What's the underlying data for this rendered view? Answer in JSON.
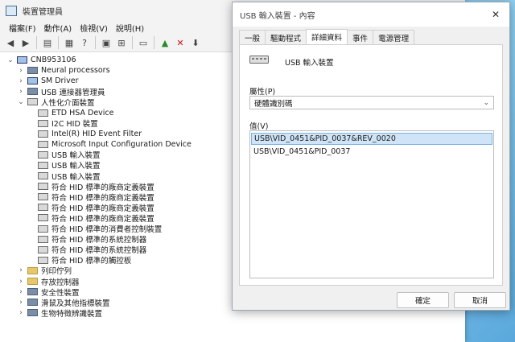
{
  "devmgr": {
    "title": "裝置管理員",
    "menu": [
      "檔案(F)",
      "動作(A)",
      "檢視(V)",
      "說明(H)"
    ],
    "tree": [
      {
        "label": "CNB953106",
        "level": 0,
        "expander": "v",
        "icon": "computer-icon"
      },
      {
        "label": "Neural processors",
        "level": 1,
        "expander": ">",
        "icon": "chip-icon"
      },
      {
        "label": "SM Driver",
        "level": 1,
        "expander": ">",
        "icon": "monitor-icon"
      },
      {
        "label": "USB 連接器管理員",
        "level": 1,
        "expander": ">",
        "icon": "usb-icon"
      },
      {
        "label": "人性化介面裝置",
        "level": 1,
        "expander": "v",
        "icon": "hid-icon"
      },
      {
        "label": "ETD HSA Device",
        "level": 2,
        "expander": "",
        "icon": "hid-icon"
      },
      {
        "label": "I2C HID 裝置",
        "level": 2,
        "expander": "",
        "icon": "hid-icon"
      },
      {
        "label": "Intel(R) HID Event Filter",
        "level": 2,
        "expander": "",
        "icon": "hid-icon"
      },
      {
        "label": "Microsoft Input Configuration Device",
        "level": 2,
        "expander": "",
        "icon": "hid-icon"
      },
      {
        "label": "USB 輸入裝置",
        "level": 2,
        "expander": "",
        "icon": "hid-icon"
      },
      {
        "label": "USB 輸入裝置",
        "level": 2,
        "expander": "",
        "icon": "hid-icon"
      },
      {
        "label": "USB 輸入裝置",
        "level": 2,
        "expander": "",
        "icon": "hid-icon"
      },
      {
        "label": "符合 HID 標準的廠商定義裝置",
        "level": 2,
        "expander": "",
        "icon": "hid-icon"
      },
      {
        "label": "符合 HID 標準的廠商定義裝置",
        "level": 2,
        "expander": "",
        "icon": "hid-icon"
      },
      {
        "label": "符合 HID 標準的廠商定義裝置",
        "level": 2,
        "expander": "",
        "icon": "hid-icon"
      },
      {
        "label": "符合 HID 標準的廠商定義裝置",
        "level": 2,
        "expander": "",
        "icon": "hid-icon"
      },
      {
        "label": "符合 HID 標準的消費者控制裝置",
        "level": 2,
        "expander": "",
        "icon": "hid-icon"
      },
      {
        "label": "符合 HID 標準的系統控制器",
        "level": 2,
        "expander": "",
        "icon": "hid-icon"
      },
      {
        "label": "符合 HID 標準的系統控制器",
        "level": 2,
        "expander": "",
        "icon": "hid-icon"
      },
      {
        "label": "符合 HID 標準的觸控板",
        "level": 2,
        "expander": "",
        "icon": "hid-icon"
      },
      {
        "label": "列印佇列",
        "level": 1,
        "expander": ">",
        "icon": "printer-icon"
      },
      {
        "label": "存放控制器",
        "level": 1,
        "expander": ">",
        "icon": "storage-icon"
      },
      {
        "label": "安全性裝置",
        "level": 1,
        "expander": ">",
        "icon": "security-icon"
      },
      {
        "label": "滑鼠及其他指標裝置",
        "level": 1,
        "expander": ">",
        "icon": "mouse-icon"
      },
      {
        "label": "生物特徵辨識裝置",
        "level": 1,
        "expander": ">",
        "icon": "biometric-icon"
      }
    ]
  },
  "dialog": {
    "title": "USB 輸入裝置 - 內容",
    "tabs": [
      "一般",
      "驅動程式",
      "詳細資料",
      "事件",
      "電源管理"
    ],
    "active_tab": 2,
    "device_name": "USB 輸入裝置",
    "property_label": "屬性(P)",
    "property_value": "硬體識別碼",
    "value_label": "值(V)",
    "values": [
      "USB\\VID_0451&PID_0037&REV_0020",
      "USB\\VID_0451&PID_0037"
    ],
    "selected_value": 0,
    "ok_label": "確定",
    "cancel_label": "取消"
  }
}
